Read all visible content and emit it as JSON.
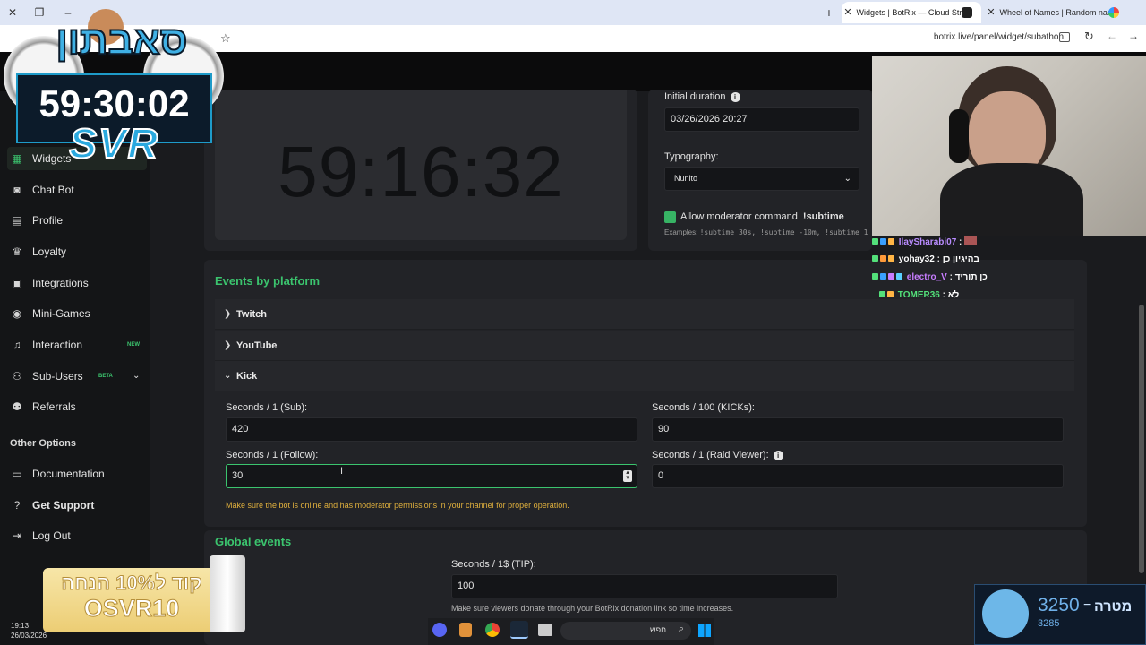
{
  "browser": {
    "tabs": [
      {
        "title": "Widgets | BotRix — Cloud Strea"
      },
      {
        "title": "Wheel of Names | Random nam"
      }
    ],
    "url": "botrix.live/panel/widget/subathon"
  },
  "sidebar": {
    "items": [
      {
        "label": "Widgets",
        "icon": "grid-icon"
      },
      {
        "label": "Chat Bot",
        "icon": "robot-icon"
      },
      {
        "label": "Profile",
        "icon": "profile-card-icon"
      },
      {
        "label": "Loyalty",
        "icon": "trophy-icon"
      },
      {
        "label": "Integrations",
        "icon": "plug-icon"
      },
      {
        "label": "Mini-Games",
        "icon": "gamepad-icon"
      },
      {
        "label": "Interaction",
        "icon": "music-note-icon",
        "badge": "NEW"
      },
      {
        "label": "Sub-Users",
        "icon": "users-icon",
        "badge": "BETA"
      },
      {
        "label": "Referrals",
        "icon": "people-icon"
      }
    ],
    "other_options_title": "Other Options",
    "other_items": [
      {
        "label": "Documentation",
        "icon": "document-icon"
      },
      {
        "label": "Get Support",
        "icon": "help-icon"
      },
      {
        "label": "Log Out",
        "icon": "logout-icon"
      }
    ]
  },
  "timer": {
    "display": "59:16:32"
  },
  "settings": {
    "initial_duration_label": "Initial duration",
    "initial_duration_value": "03/26/2026 20:27",
    "typography_label": "Typography:",
    "typography_value": "Nunito",
    "allow_mod_label": "Allow moderator command",
    "allow_mod_command": "!subtime",
    "examples_label": "Examples:",
    "examples_text": "!subtime 30s, !subtime -10m, !subtime 1"
  },
  "events": {
    "title": "Events by platform",
    "platforms": [
      "Twitch",
      "YouTube",
      "Kick"
    ],
    "kick": {
      "sub_label": "Seconds / 1 (Sub):",
      "sub_value": "420",
      "kicks_label": "Seconds / 100 (KICKs):",
      "kicks_value": "90",
      "follow_label": "Seconds / 1 (Follow):",
      "follow_value": "30",
      "raid_label": "Seconds / 1 (Raid Viewer):",
      "raid_value": "0",
      "warning": "Make sure the bot is online and has moderator permissions in your channel for proper operation."
    }
  },
  "global_events": {
    "title": "Global events",
    "tip_label": "Seconds / 1$ (TIP):",
    "tip_value": "100",
    "tip_hint": "Make sure viewers donate through your BotRix donation link so time increases."
  },
  "overlay": {
    "clock_time": "59:30:02",
    "clock_tag": "SVR",
    "clock_heb": "סאבתון",
    "chat": [
      {
        "user": "IlaySharabi07",
        "msg": "",
        "color": "#b98cff"
      },
      {
        "user": "yohay32",
        "msg": "בהיגיון כן",
        "color": "#ffffff"
      },
      {
        "user": "electro_V",
        "msg": "כן תוריד",
        "color": "#c77dff"
      },
      {
        "user": "TOMER36",
        "msg": "לא",
        "color": "#53e07a"
      }
    ],
    "promo_line1": "קוד ל10% הנחה",
    "promo_line2": "OSVR10",
    "goal_value": "3250",
    "goal_label": "מטרה",
    "goal_sub": "3285",
    "goal_dash": "−",
    "taskbar_search": "חפש",
    "sys_time": "19:13",
    "sys_date": "26/03/2026"
  }
}
